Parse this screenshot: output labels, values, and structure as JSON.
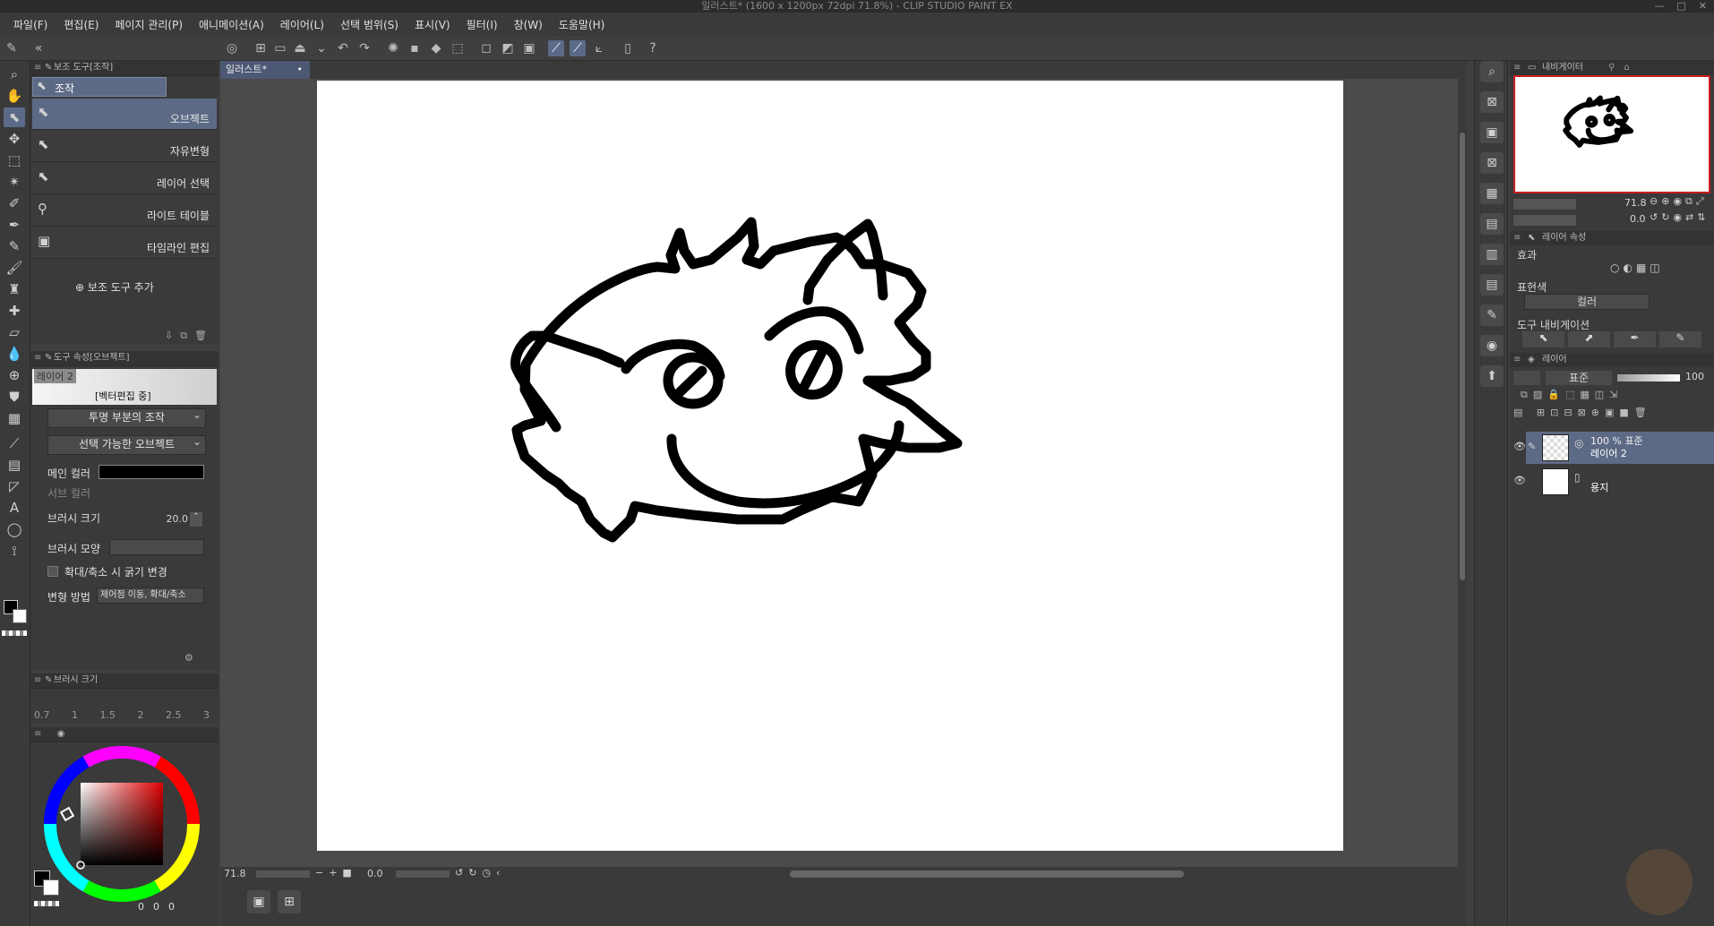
{
  "window": {
    "title": "일러스트* (1600 x 1200px 72dpi 71.8%)  - CLIP STUDIO PAINT EX",
    "controls": [
      "—",
      "□",
      "✕"
    ]
  },
  "menu": [
    "파일(F)",
    "편집(E)",
    "페이지 관리(P)",
    "애니메이션(A)",
    "레이어(L)",
    "선택 범위(S)",
    "표시(V)",
    "필터(I)",
    "창(W)",
    "도움말(H)"
  ],
  "subtool_panel": {
    "title": "보조 도구[조작]",
    "group": "조작",
    "items": [
      "오브젝트",
      "자유변형",
      "레이어 선택",
      "라이트 테이블",
      "타임라인 편집"
    ],
    "add_label": "보조 도구 추가"
  },
  "tool_property": {
    "title": "도구 속성[오브젝트]",
    "layer_name": "레이어 2",
    "mode_label": "[벡터편집 중]",
    "transparent_op": "투명 부분의 조작",
    "selectable_object": "선택 가능한 오브젝트",
    "main_color_label": "메인 컬러",
    "sub_color_label": "서브 컬러",
    "brush_size_label": "브러시 크기",
    "brush_size_value": "20.0",
    "brush_shape_label": "브러시 모양",
    "scale_checkbox_label": "확대/축소 시 굵기 변경",
    "transform_label": "변형 방법",
    "transform_value": "제어점 이동, 확대/축소"
  },
  "brush_size_panel": {
    "title": "브러시 크기",
    "sizes": [
      "0.7",
      "1",
      "1.5",
      "2",
      "2.5",
      "3"
    ]
  },
  "color_wheel": {
    "h_value": "0",
    "s_value": "0",
    "v_value": "0",
    "main_color": "#000000",
    "sub_color": "#ffffff"
  },
  "document": {
    "tab_label": "일러스트*",
    "tab_close": "•",
    "zoom": "71.8",
    "rotation": "0.0"
  },
  "navigator": {
    "title": "내비게이터",
    "zoom": "71.8",
    "rotation": "0.0"
  },
  "layer_property": {
    "title": "레이어 속성",
    "effect_label": "효과",
    "expression_label": "표현색",
    "expression_value": "컬러",
    "tool_nav_label": "도구 내비게이션"
  },
  "layer_panel": {
    "title": "레이어",
    "blend_mode": "표준",
    "opacity": "100",
    "layers": [
      {
        "meta": "100 % 표준",
        "name": "레이어 2",
        "selected": true
      },
      {
        "meta": "",
        "name": "용지",
        "selected": false
      }
    ]
  },
  "colors": {
    "accent": "#5d6a86",
    "panel_bg": "#3a3a3a",
    "canvas_bg": "#4b4b4b",
    "nav_border": "#c81e1e"
  }
}
